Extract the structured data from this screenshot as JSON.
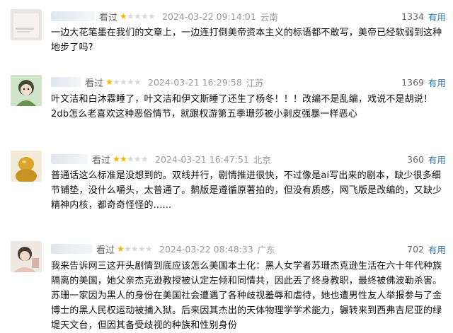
{
  "reviews": [
    {
      "username": "[obscured]",
      "rating_label": "看过",
      "stars": 1,
      "time": "2024-03-22 09:14:01",
      "location": "云南",
      "votes": "1334",
      "useful_label": "有用",
      "content": "一边大花笔墨在我们的文章上，一边连打倒美帝资本主义的标语都不敢写，美帝已经软弱到这种地步了吗?",
      "avatar_icon": "avatar-photo-icon"
    },
    {
      "username": "[obscured]",
      "rating_label": "看过",
      "stars": 1,
      "time": "2024-03-21 16:29:58",
      "location": "江苏",
      "votes": "1369",
      "useful_label": "有用",
      "content": "叶文洁和白沐霖睡了，叶文洁和伊文斯睡了还生了杨冬！！！改编不是乱编，戏说不是胡说！2db怎么老喜欢这种恶俗情节，就跟权游第五季珊莎被小剥皮强暴一样恶心",
      "avatar_icon": "avatar-anime-girl-icon"
    },
    {
      "username": "[obscured]东",
      "rating_label": "看过",
      "stars": 2,
      "time": "2024-03-21 16:47:51",
      "location": "北京",
      "votes": "360",
      "useful_label": "有用",
      "content": "普通话这么标准是没想到的。双线并行，剧情推进很快，不过像是ai写出来的剧本，缺少很多细节铺垫，没什么嚼头，太普通了。鹅版是遵循原著拍的，但没有质感，网飞版是改编的，又缺少精神内核，都奇奇怪怪的......",
      "avatar_icon": "avatar-gold-figure-icon"
    },
    {
      "username": "[obscured]",
      "rating_label": "看过",
      "stars": 1,
      "time": "2024-03-22 08:48:33",
      "location": "广东",
      "votes": "702",
      "useful_label": "有用",
      "content": "我来告诉网三这开头剧情到底应该怎么美国本土化：黑人女学者苏珊杰克逊生活在六十年代种族隔离的美国，她父亲杰克逊教授被认定左倾和同情共，因此丢了终身教职，最终被佛波勒杀害。苏珊一家因为黑人的身份在美国社会遭遇了各种歧视羞辱和虐待，她也遭男性友人举报参与了金博士的黑人民权运动被捕入狱。后来因其杰出的天体物理学学术能力，辗转来到西弗吉尼亚的绿堤天文台，但因其备受歧视的种族和性别身份",
      "avatar_icon": "avatar-photo-girl-icon"
    }
  ]
}
